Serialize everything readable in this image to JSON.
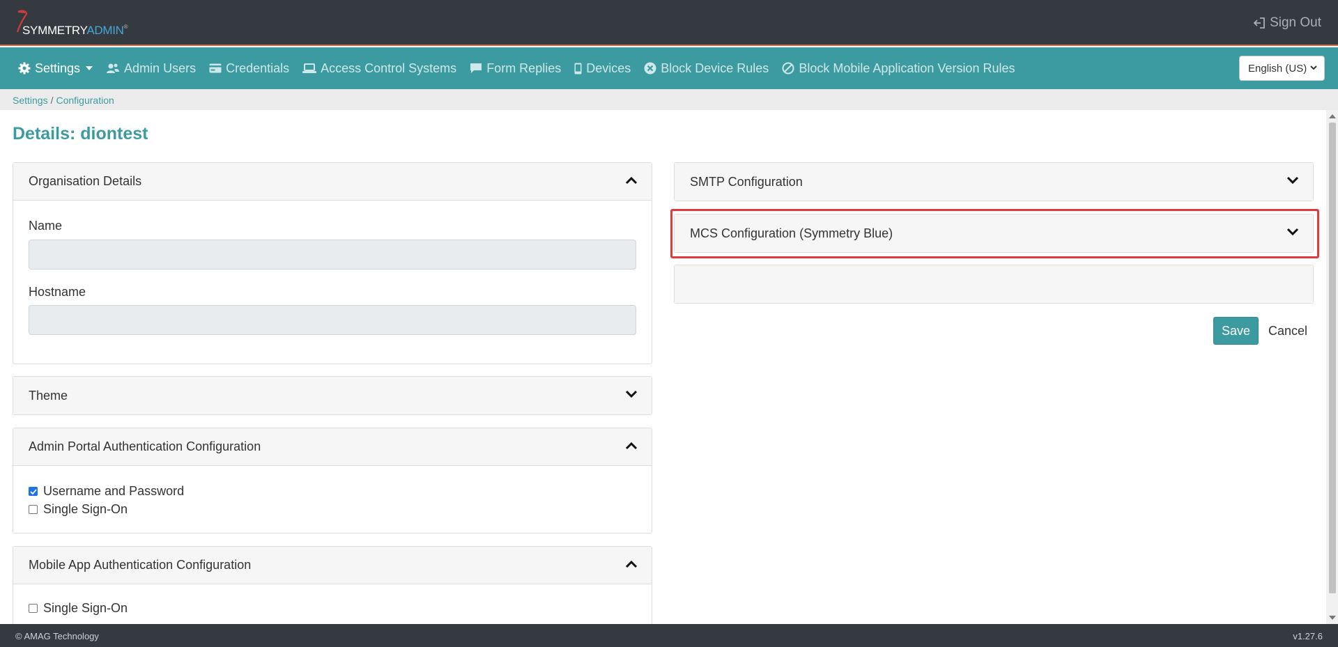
{
  "header": {
    "logo_primary": "SYMMETRY",
    "logo_secondary": "ADMIN",
    "logo_tm": "®",
    "signout_label": "Sign Out"
  },
  "nav": {
    "items": [
      {
        "label": "Settings",
        "icon": "gear-icon"
      },
      {
        "label": "Admin Users",
        "icon": "users-icon"
      },
      {
        "label": "Credentials",
        "icon": "card-icon"
      },
      {
        "label": "Access Control Systems",
        "icon": "laptop-icon"
      },
      {
        "label": "Form Replies",
        "icon": "comment-icon"
      },
      {
        "label": "Devices",
        "icon": "mobile-icon"
      },
      {
        "label": "Block Device Rules",
        "icon": "x-circle-icon"
      },
      {
        "label": "Block Mobile Application Version Rules",
        "icon": "ban-icon"
      }
    ],
    "language": "English (US)"
  },
  "breadcrumb": {
    "items": [
      "Settings",
      "Configuration"
    ],
    "separator": "/"
  },
  "page": {
    "title": "Details: diontest"
  },
  "left_panels": {
    "org": {
      "title": "Organisation Details",
      "name_label": "Name",
      "name_value": "",
      "hostname_label": "Hostname",
      "hostname_value": ""
    },
    "theme": {
      "title": "Theme"
    },
    "admin_auth": {
      "title": "Admin Portal Authentication Configuration",
      "options": [
        {
          "label": "Username and Password",
          "checked": true
        },
        {
          "label": "Single Sign-On",
          "checked": false
        }
      ]
    },
    "mobile_auth": {
      "title": "Mobile App Authentication Configuration",
      "options": [
        {
          "label": "Single Sign-On",
          "checked": false
        }
      ]
    }
  },
  "right_panels": {
    "smtp": {
      "title": "SMTP Configuration"
    },
    "mcs": {
      "title": "MCS Configuration (Symmetry Blue)"
    },
    "empty": {
      "title": ""
    }
  },
  "actions": {
    "save_label": "Save",
    "cancel_label": "Cancel"
  },
  "footer": {
    "copyright": "© AMAG Technology",
    "version": "v1.27.6"
  },
  "colors": {
    "header_bg": "#343a40",
    "nav_bg": "#3c9ba0",
    "accent": "#3c9ba0",
    "highlight": "#e0393e",
    "logo_admin": "#46a6d4"
  }
}
